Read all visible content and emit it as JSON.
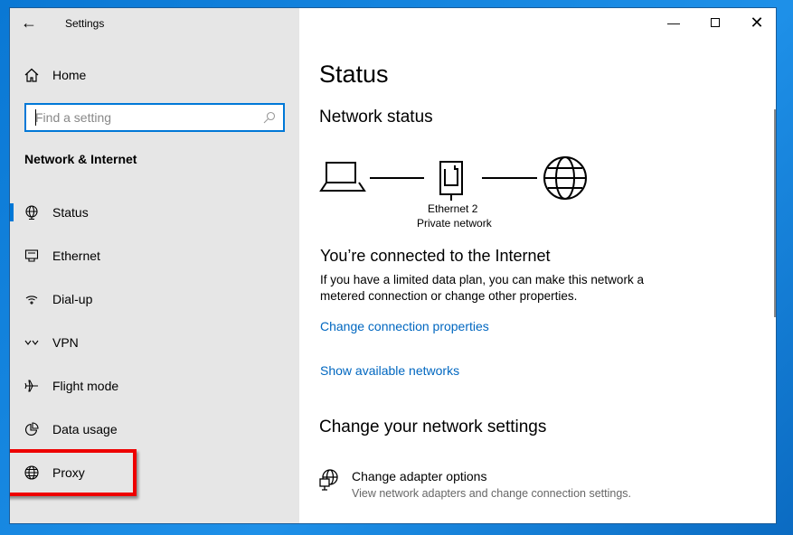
{
  "window": {
    "title": "Settings",
    "controls": [
      "minimize",
      "maximize",
      "close"
    ]
  },
  "sidebar": {
    "home": "Home",
    "search": {
      "placeholder": "Find a setting",
      "value": ""
    },
    "section": "Network & Internet",
    "items": [
      {
        "label": "Status",
        "icon": "globe-network-icon",
        "selected": true
      },
      {
        "label": "Ethernet",
        "icon": "ethernet-icon"
      },
      {
        "label": "Dial-up",
        "icon": "dial-up-icon"
      },
      {
        "label": "VPN",
        "icon": "vpn-icon"
      },
      {
        "label": "Flight mode",
        "icon": "airplane-icon"
      },
      {
        "label": "Data usage",
        "icon": "pie-chart-icon"
      },
      {
        "label": "Proxy",
        "icon": "globe-icon",
        "highlighted": true
      }
    ]
  },
  "main": {
    "title": "Status",
    "network_status": "Network status",
    "adapter_name": "Ethernet 2",
    "network_type": "Private network",
    "connected": "You’re connected to the Internet",
    "description": "If you have a limited data plan, you can make this network a metered connection or change other properties.",
    "change_props": "Change connection properties",
    "show_networks": "Show available networks",
    "change_heading": "Change your network settings",
    "adapter_options": {
      "title": "Change adapter options",
      "subtitle": "View network adapters and change connection settings."
    }
  },
  "colors": {
    "accent": "#0078d7",
    "link": "#0067c0",
    "highlight": "#e00000"
  }
}
